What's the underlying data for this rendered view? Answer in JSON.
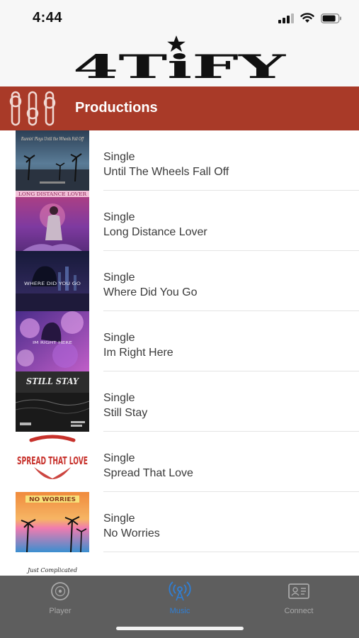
{
  "status_bar": {
    "time": "4:44"
  },
  "logo": {
    "text": "4TiFY"
  },
  "header": {
    "title": "Productions"
  },
  "releases": [
    {
      "kind": "Single",
      "title": "Until The Wheels Fall Off",
      "art_text": "Runnin' Plays Until the Wheels Fall Off"
    },
    {
      "kind": "Single",
      "title": "Long Distance Lover",
      "art_text": "LONG DISTANCE LOVER"
    },
    {
      "kind": "Single",
      "title": "Where Did You Go",
      "art_text": "WHERE DID YOU GO"
    },
    {
      "kind": "Single",
      "title": "Im Right Here",
      "art_text": "IM RIGHT HERE"
    },
    {
      "kind": "Single",
      "title": "Still Stay",
      "art_text": "STILL STAY"
    },
    {
      "kind": "Single",
      "title": "Spread That Love",
      "art_text": "SPREAD THAT LOVE"
    },
    {
      "kind": "Single",
      "title": "No Worries",
      "art_text": "NO WORRIES"
    }
  ],
  "partial_art_text": "Just Complicated",
  "tabs": [
    {
      "label": "Player",
      "icon": "disc-icon",
      "active": false
    },
    {
      "label": "Music",
      "icon": "broadcast-icon",
      "active": true
    },
    {
      "label": "Connect",
      "icon": "contact-card-icon",
      "active": false
    }
  ],
  "colors": {
    "header": "#a93a28",
    "tab_active": "#2f7fd6",
    "tab_inactive": "#a9a9a9",
    "tabbar": "#5e5e5e"
  }
}
